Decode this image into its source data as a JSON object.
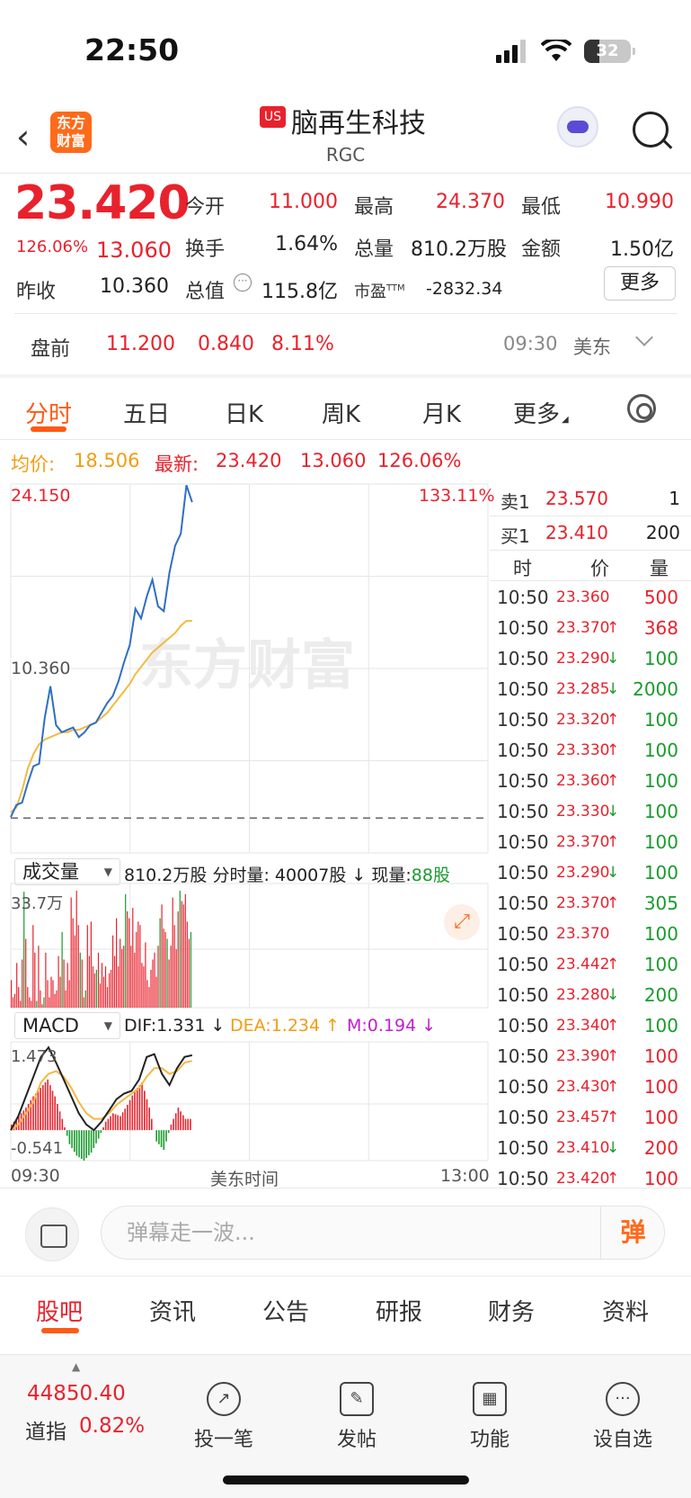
{
  "status_bar": {
    "time": "22:50",
    "battery": "32",
    "battery_level": 0.32
  },
  "header": {
    "brand_logo": "东方财富",
    "market_badge": "US",
    "stock_name": "脑再生科技",
    "stock_code": "RGC",
    "icons": [
      "back-chevron-icon",
      "robot-assistant-icon",
      "search-icon"
    ]
  },
  "quote": {
    "price": "23.420",
    "change_pct": "126.06%",
    "change_amt": "13.060",
    "prev_close_label": "昨收",
    "prev_close": "10.360",
    "open_label": "今开",
    "open": "11.000",
    "high_label": "最高",
    "high": "24.370",
    "low_label": "最低",
    "low": "10.990",
    "turnover_label": "换手",
    "turnover": "1.64%",
    "volume_label": "总量",
    "volume": "810.2万股",
    "amount_label": "金额",
    "amount": "1.50亿",
    "mktcap_label": "总值",
    "mktcap": "115.8亿",
    "pe_label": "市盈",
    "pe_sup": "TTM",
    "pe": "-2832.34",
    "more_button": "更多"
  },
  "premarket": {
    "label": "盘前",
    "price": "11.200",
    "change": "0.840",
    "change_pct": "8.11%",
    "time": "09:30",
    "timezone": "美东"
  },
  "tabs": [
    "分时",
    "五日",
    "日K",
    "周K",
    "月K",
    "更多"
  ],
  "avg_row": {
    "avg_label": "均价:",
    "avg_value": "18.506",
    "latest_label": "最新:",
    "latest_price": "23.420",
    "latest_change": "13.060",
    "latest_pct": "126.06%"
  },
  "chart_labels": {
    "y_top": "24.150",
    "y_mid": "10.360",
    "pct_top": "133.11%",
    "watermark": "东方财富",
    "x_start": "09:30",
    "x_mid": "美东时间",
    "x_end": "13:00"
  },
  "volume_panel": {
    "dropdown": "成交量",
    "total": "810.2万股",
    "tick_label": "分时量:",
    "tick_value": "40007股",
    "now_label": "现量:",
    "now_value": "88股",
    "y_max": "33.7万"
  },
  "macd_panel": {
    "dropdown": "MACD",
    "dif": "DIF:1.331 ↓",
    "dea": "DEA:1.234 ↑",
    "m": "M:0.194 ↓",
    "y_max": "1.473",
    "y_min": "-0.541"
  },
  "orderbook": {
    "ask": {
      "label": "卖1",
      "price": "23.570",
      "qty": "1"
    },
    "bid": {
      "label": "买1",
      "price": "23.410",
      "qty": "200"
    },
    "headers": [
      "时",
      "价",
      "量"
    ]
  },
  "ticks": [
    {
      "t": "10:50",
      "p": "23.360",
      "d": "",
      "v": "500",
      "vc": "red"
    },
    {
      "t": "10:50",
      "p": "23.370",
      "d": "↑",
      "v": "368",
      "vc": "red"
    },
    {
      "t": "10:50",
      "p": "23.290",
      "d": "↓",
      "v": "100",
      "vc": "green"
    },
    {
      "t": "10:50",
      "p": "23.285",
      "d": "↓",
      "v": "2000",
      "vc": "green"
    },
    {
      "t": "10:50",
      "p": "23.320",
      "d": "↑",
      "v": "100",
      "vc": "green"
    },
    {
      "t": "10:50",
      "p": "23.330",
      "d": "↑",
      "v": "100",
      "vc": "green"
    },
    {
      "t": "10:50",
      "p": "23.360",
      "d": "↑",
      "v": "100",
      "vc": "green"
    },
    {
      "t": "10:50",
      "p": "23.330",
      "d": "↓",
      "v": "100",
      "vc": "green"
    },
    {
      "t": "10:50",
      "p": "23.370",
      "d": "↑",
      "v": "100",
      "vc": "green"
    },
    {
      "t": "10:50",
      "p": "23.290",
      "d": "↓",
      "v": "100",
      "vc": "green"
    },
    {
      "t": "10:50",
      "p": "23.370",
      "d": "↑",
      "v": "305",
      "vc": "green"
    },
    {
      "t": "10:50",
      "p": "23.370",
      "d": "",
      "v": "100",
      "vc": "green"
    },
    {
      "t": "10:50",
      "p": "23.442",
      "d": "↑",
      "v": "100",
      "vc": "green"
    },
    {
      "t": "10:50",
      "p": "23.280",
      "d": "↓",
      "v": "200",
      "vc": "green"
    },
    {
      "t": "10:50",
      "p": "23.340",
      "d": "↑",
      "v": "100",
      "vc": "green"
    },
    {
      "t": "10:50",
      "p": "23.390",
      "d": "↑",
      "v": "100",
      "vc": "red"
    },
    {
      "t": "10:50",
      "p": "23.430",
      "d": "↑",
      "v": "100",
      "vc": "red"
    },
    {
      "t": "10:50",
      "p": "23.457",
      "d": "↑",
      "v": "100",
      "vc": "red"
    },
    {
      "t": "10:50",
      "p": "23.410",
      "d": "↓",
      "v": "200",
      "vc": "red"
    },
    {
      "t": "10:50",
      "p": "23.420",
      "d": "↑",
      "v": "100",
      "vc": "red"
    }
  ],
  "comment_bar": {
    "placeholder": "弹幕走一波...",
    "danmu_button": "弹"
  },
  "bottom_tabs": [
    "股吧",
    "资讯",
    "公告",
    "研报",
    "财务",
    "资料"
  ],
  "footer": {
    "index_value": "44850.40",
    "index_name": "道指",
    "index_pct": "0.82%",
    "items": [
      {
        "label": "投一笔",
        "icon": "trend-icon"
      },
      {
        "label": "发帖",
        "icon": "edit-icon"
      },
      {
        "label": "功能",
        "icon": "grid-icon"
      },
      {
        "label": "设自选",
        "icon": "more-dots-icon"
      }
    ]
  },
  "colors": {
    "up": "#e8222d",
    "down": "#1a9b2e",
    "accent": "#ff5a14",
    "price_line": "#2f6fc4",
    "avg_line": "#f5b942"
  },
  "chart_data": {
    "type": "line",
    "price_series": [
      10.4,
      10.9,
      11.0,
      11.8,
      12.5,
      12.6,
      14.5,
      15.8,
      14.2,
      13.9,
      14.0,
      14.1,
      13.7,
      13.9,
      14.2,
      14.3,
      14.7,
      15.1,
      15.4,
      16.0,
      16.8,
      17.5,
      19.0,
      18.6,
      19.5,
      20.2,
      19.1,
      18.9,
      20.5,
      21.6,
      22.1,
      24.1,
      23.4
    ],
    "avg_series": [
      10.6,
      10.8,
      11.5,
      12.4,
      13.0,
      13.4,
      13.6,
      13.7,
      13.8,
      13.9,
      13.9,
      14.0,
      14.0,
      14.1,
      14.2,
      14.3,
      14.5,
      14.7,
      15.0,
      15.3,
      15.6,
      15.9,
      16.3,
      16.6,
      16.9,
      17.2,
      17.4,
      17.6,
      17.8,
      18.0,
      18.3,
      18.5,
      18.5
    ],
    "ylim": [
      8.92,
      24.15
    ],
    "prev_close": 10.36,
    "volume_bars": [
      8,
      3,
      4,
      13,
      6,
      2,
      14,
      33.7,
      20,
      6,
      3,
      2,
      24,
      16,
      2,
      18,
      5,
      1,
      3,
      16,
      8,
      3,
      9,
      8,
      4,
      5,
      15,
      9,
      22,
      14,
      5,
      13,
      8,
      32,
      26,
      21,
      34,
      24,
      16,
      14,
      3,
      5,
      24,
      15,
      25,
      12,
      10,
      11,
      16,
      7,
      13,
      9,
      12,
      6,
      10,
      11,
      21,
      15,
      26,
      12,
      20,
      17,
      18,
      33,
      28,
      26,
      18,
      29,
      16,
      22,
      25,
      24,
      13,
      12,
      19,
      8,
      6,
      11,
      14,
      16,
      9,
      18,
      26,
      30,
      23,
      22,
      20,
      14,
      18,
      32,
      24,
      17,
      28,
      34,
      31,
      30,
      33,
      25,
      20,
      22
    ],
    "volume_color": [
      "red",
      "red",
      "red",
      "red",
      "red",
      "red",
      "red",
      "green",
      "red",
      "red",
      "red",
      "red",
      "red",
      "red",
      "green",
      "red",
      "red",
      "red",
      "green",
      "red",
      "red",
      "red",
      "red",
      "red",
      "red",
      "red",
      "red",
      "red",
      "green",
      "red",
      "red",
      "red",
      "red",
      "red",
      "red",
      "red",
      "red",
      "red",
      "green",
      "red",
      "red",
      "green",
      "red",
      "red",
      "red",
      "red",
      "red",
      "green",
      "red",
      "red",
      "red",
      "red",
      "red",
      "red",
      "red",
      "red",
      "red",
      "red",
      "red",
      "red",
      "red",
      "red",
      "red",
      "green",
      "red",
      "red",
      "red",
      "red",
      "red",
      "red",
      "red",
      "red",
      "red",
      "red",
      "red",
      "red",
      "red",
      "red",
      "red",
      "red",
      "red",
      "red",
      "green",
      "red",
      "red",
      "red",
      "green",
      "red",
      "red",
      "red",
      "red",
      "red",
      "red",
      "green",
      "red",
      "red",
      "red",
      "red",
      "red",
      "green"
    ],
    "macd_dif": [
      0.0,
      0.25,
      0.6,
      0.95,
      1.3,
      1.47,
      1.2,
      0.9,
      0.6,
      0.3,
      0.1,
      0.0,
      0.15,
      0.35,
      0.55,
      0.65,
      0.7,
      0.9,
      1.3,
      1.35,
      1.0,
      0.8,
      1.1,
      1.3,
      1.33
    ],
    "macd_dea": [
      0.0,
      0.1,
      0.3,
      0.5,
      0.85,
      1.0,
      1.05,
      0.95,
      0.75,
      0.5,
      0.3,
      0.2,
      0.2,
      0.3,
      0.45,
      0.55,
      0.65,
      0.75,
      0.95,
      1.1,
      1.1,
      1.0,
      1.05,
      1.2,
      1.23
    ],
    "macd_hist": [
      0.1,
      0.25,
      0.4,
      0.6,
      0.75,
      0.9,
      0.6,
      0.2,
      -0.25,
      -0.45,
      -0.54,
      -0.4,
      -0.15,
      0.15,
      0.3,
      0.25,
      0.45,
      0.7,
      0.85,
      0.4,
      -0.2,
      -0.35,
      0.1,
      0.4,
      0.2
    ],
    "macd_ylim": [
      -0.541,
      1.473
    ]
  }
}
